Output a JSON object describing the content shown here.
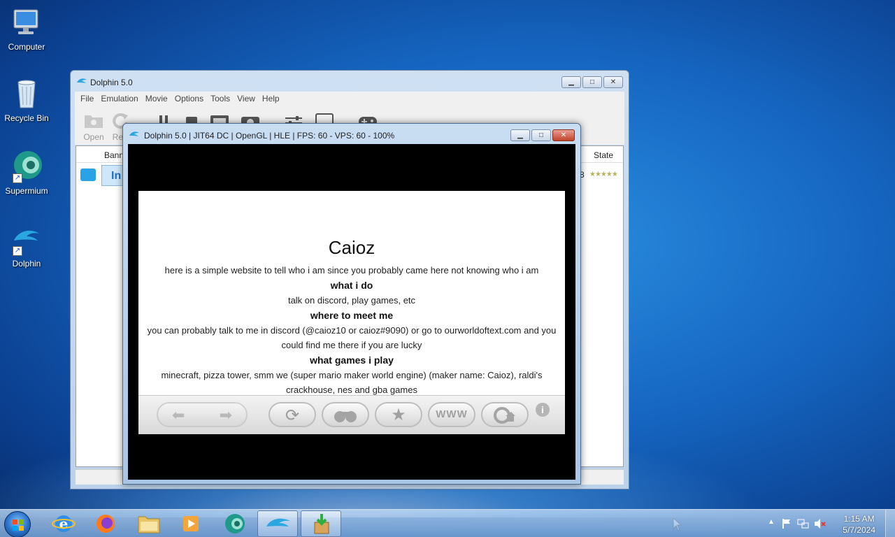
{
  "desktop": {
    "icons": [
      {
        "label": "Computer"
      },
      {
        "label": "Recycle Bin"
      },
      {
        "label": "Supermium"
      },
      {
        "label": "Dolphin"
      }
    ]
  },
  "main_window": {
    "title": "Dolphin 5.0",
    "menu": [
      "File",
      "Emulation",
      "Movie",
      "Options",
      "Tools",
      "View",
      "Help"
    ],
    "toolbar": {
      "open_label": "Open",
      "refresh_label": "Refr"
    },
    "list": {
      "columns": {
        "banner": "Bann",
        "state": "State"
      },
      "row": {
        "title_fragment": "In",
        "partial_value": "8",
        "state_stars": "★★★★★"
      }
    }
  },
  "render_window": {
    "title": "Dolphin 5.0 | JIT64 DC | OpenGL | HLE | FPS: 60 - VPS: 60 - 100%",
    "page": {
      "heading": "Caioz",
      "intro": "here is a simple website to tell who i am since you probably came here not knowing who i am",
      "sections": [
        {
          "title": "what i do",
          "body": "talk on discord, play games, etc"
        },
        {
          "title": "where to meet me",
          "body": "you can probably talk to me in discord (@caioz10 or caioz#9090) or go to ourworldoftext.com and you could find me there if you are lucky"
        },
        {
          "title": "what games i play",
          "body": "minecraft, pizza tower, smm we (super mario maker world engine) (maker name: Caioz), raldi's crackhouse, nes and gba games"
        }
      ]
    },
    "wii_buttons": {
      "www_label": "WWW",
      "info_label": "i"
    }
  },
  "taskbar": {
    "items": [
      "internet-explorer",
      "firefox",
      "file-explorer",
      "media-player",
      "supermium",
      "dolphin",
      "installer"
    ],
    "clock": {
      "time": "1:15 AM",
      "date": "5/7/2024"
    }
  },
  "colors": {
    "accent": "#1e88e5",
    "dolphin": "#2aa7e0"
  }
}
